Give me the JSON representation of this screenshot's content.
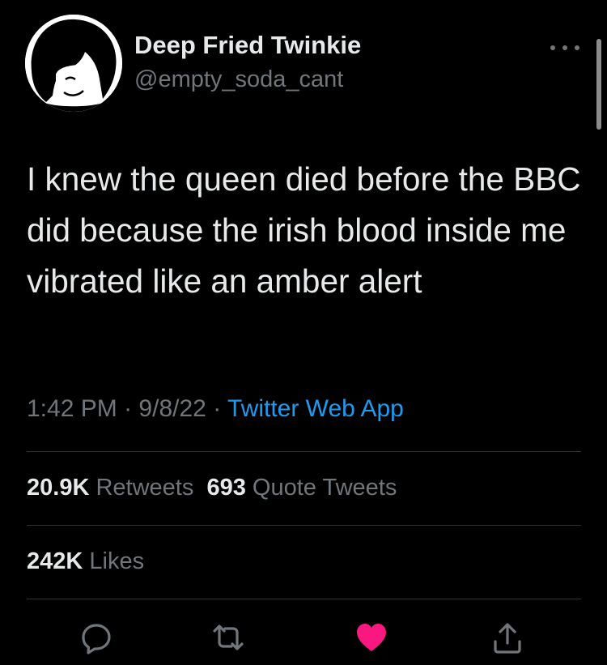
{
  "author": {
    "display_name": "Deep Fried Twinkie",
    "handle": "@empty_soda_cant"
  },
  "tweet": {
    "text": "I knew the queen died before the BBC did because the irish blood inside me vibrated like an amber alert",
    "time": "1:42 PM",
    "date": "9/8/22",
    "separator": "·",
    "source": "Twitter Web App"
  },
  "stats": {
    "retweets_count": "20.9K",
    "retweets_label": "Retweets",
    "quotes_count": "693",
    "quotes_label": "Quote Tweets",
    "likes_count": "242K",
    "likes_label": "Likes"
  },
  "actions": {
    "reply_icon": "reply-icon",
    "retweet_icon": "retweet-icon",
    "like_icon": "heart-icon",
    "share_icon": "share-icon",
    "liked": true
  },
  "colors": {
    "background": "#000000",
    "text": "#e7e9ea",
    "secondary": "#71767b",
    "link": "#1d9bf0",
    "like": "#f91880"
  }
}
